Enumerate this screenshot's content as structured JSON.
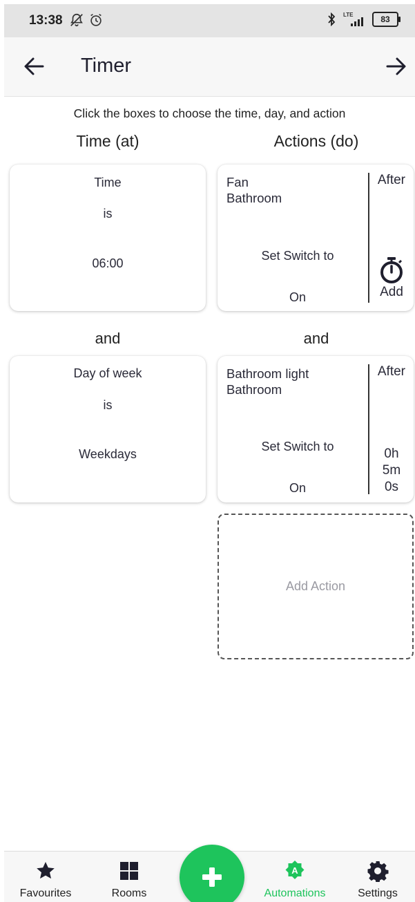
{
  "status_bar": {
    "time": "13:38",
    "lte": "LTE",
    "battery": "83"
  },
  "header": {
    "title": "Timer"
  },
  "hint": "Click the boxes to choose the time, day, and action",
  "columns": {
    "left": "Time (at)",
    "right": "Actions (do)"
  },
  "and_label": "and",
  "conditions": [
    {
      "field": "Time",
      "op": "is",
      "value": "06:00"
    },
    {
      "field": "Day of week",
      "op": "is",
      "value": "Weekdays"
    }
  ],
  "actions": [
    {
      "device": "Fan",
      "room": "Bathroom",
      "command": "Set Switch to",
      "state": "On",
      "after_label": "After",
      "delay_label": "Add",
      "icon": "stopwatch-icon"
    },
    {
      "device": "Bathroom light",
      "room": "Bathroom",
      "command": "Set Switch to",
      "state": "On",
      "after_label": "After",
      "delay_h": "0h",
      "delay_m": "5m",
      "delay_s": "0s"
    }
  ],
  "add_action": "Add Action",
  "nav": {
    "favourites": "Favourites",
    "rooms": "Rooms",
    "automations": "Automations",
    "settings": "Settings",
    "accent": "#1ec45c"
  }
}
